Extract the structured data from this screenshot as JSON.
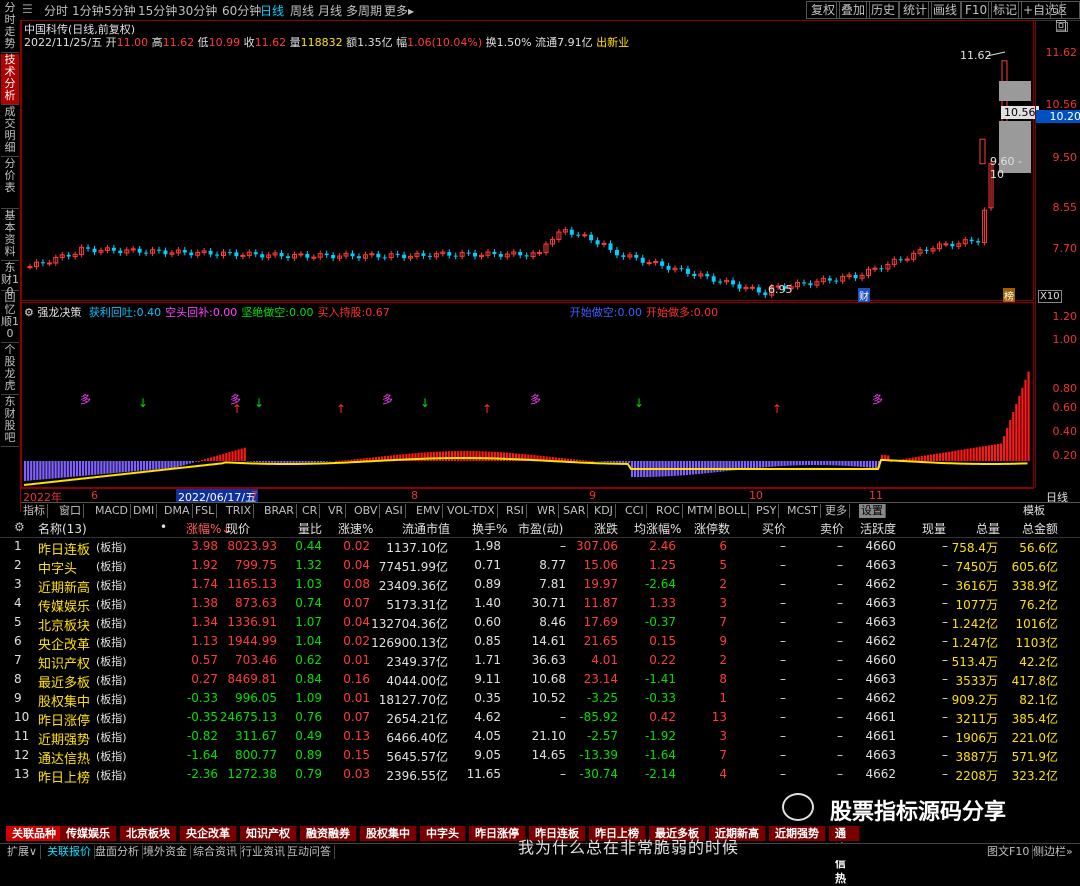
{
  "left_tabs": [
    "分时走势",
    "技术分析",
    "成交明细",
    "分价表",
    "基本资料",
    "东财10",
    "回忆顺10",
    "个股龙虎",
    "东财股吧"
  ],
  "left_active": 1,
  "periods": [
    "分时",
    "1分钟",
    "5分钟",
    "15分钟",
    "30分钟",
    "60分钟",
    "日线",
    "周线",
    "月线",
    "多周期",
    "更多▸"
  ],
  "period_active": 6,
  "right_tools": [
    "复权",
    "叠加",
    "历史",
    "统计",
    "画线",
    "F10",
    "标记",
    "+自选",
    "返回"
  ],
  "stock_title": "中国科传(日线,前复权)",
  "info": {
    "date": "2022/11/25/五",
    "open_l": "开",
    "open": "11.00",
    "high_l": "高",
    "high": "11.62",
    "low_l": "低",
    "low": "10.99",
    "close_l": "收",
    "close": "11.62",
    "vol_l": "量",
    "vol": "118832",
    "amt": "额1.35亿",
    "amp_l": "幅",
    "amp": "1.06(10.04%)",
    "turn": "换1.50%",
    "float": "流通7.91亿",
    "flag": "出新业"
  },
  "price_labels": {
    "high": "11.62",
    "cur": "10.56",
    "cur2": "10.20",
    "range": "9.60 - 10",
    "low": "6.95",
    "cai": "财",
    "bang": "榜",
    "x10": "X10"
  },
  "y_axis_k": [
    "11.62",
    "10.56",
    "9.50",
    "8.55",
    "7.70"
  ],
  "y_axis_ind": [
    "1.20",
    "1.00",
    "0.80",
    "0.60",
    "0.40",
    "0.20"
  ],
  "indicator": {
    "name": "强龙决策",
    "items": [
      {
        "l": "获利回吐:",
        "v": "0.40",
        "c": "#00c0ff"
      },
      {
        "l": "空头回补:",
        "v": "0.00",
        "c": "#ff40ff"
      },
      {
        "l": "坚绝做空:",
        "v": "0.00",
        "c": "#00e000"
      },
      {
        "l": "买入持股:",
        "v": "0.67",
        "c": "#ff3030"
      },
      {
        "l": "开始做空:",
        "v": "0.00",
        "c": "#4060ff"
      },
      {
        "l": "开始做多:",
        "v": "0.00",
        "c": "#ff3030"
      }
    ]
  },
  "duo": "多",
  "x_axis": [
    {
      "t": "2022年",
      "p": 2
    },
    {
      "t": "6",
      "p": 70
    },
    {
      "t": "2022/06/17/五",
      "p": 155,
      "h": true
    },
    {
      "t": "7",
      "p": 230
    },
    {
      "t": "8",
      "p": 390
    },
    {
      "t": "9",
      "p": 568
    },
    {
      "t": "10",
      "p": 728
    },
    {
      "t": "11",
      "p": 848
    }
  ],
  "x_axis_right": "日线",
  "ind_tabs": [
    "指标",
    "窗口",
    "MACD",
    "DMI",
    "DMA",
    "FSL",
    "TRIX",
    "BRAR",
    "CR",
    "VR",
    "OBV",
    "ASI",
    "EMV",
    "VOL-TDX",
    "RSI",
    "WR",
    "SAR",
    "KDJ",
    "CCI",
    "ROC",
    "MTM",
    "BOLL",
    "PSY",
    "MCST",
    "更多",
    "设置"
  ],
  "ind_tab_active": 25,
  "ind_tabs_right": "模板",
  "table_header": [
    "名称(13)",
    "•",
    "涨幅%↓",
    "现价",
    "量比",
    "涨速%",
    "流通市值",
    "换手%",
    "市盈(动)",
    "涨跌",
    "均涨幅%",
    "涨停数",
    "买价",
    "卖价",
    "活跃度",
    "现量",
    "总量",
    "总金额"
  ],
  "rows": [
    [
      "1",
      "昨日连板",
      "(板指)",
      "3.98",
      "8023.93",
      "0.44",
      "0.02",
      "1137.10亿",
      "1.98",
      "–",
      "307.06",
      "2.46",
      "6",
      "–",
      "–",
      "4660",
      "–",
      "758.4万",
      "56.6亿"
    ],
    [
      "2",
      "中字头",
      "(板指)",
      "1.92",
      "799.75",
      "1.32",
      "0.04",
      "77451.99亿",
      "0.71",
      "8.77",
      "15.06",
      "1.25",
      "5",
      "–",
      "–",
      "4663",
      "–",
      "7450万",
      "605.6亿"
    ],
    [
      "3",
      "近期新高",
      "(板指)",
      "1.74",
      "1165.13",
      "1.03",
      "0.08",
      "23409.36亿",
      "0.89",
      "7.81",
      "19.97",
      "-2.64",
      "2",
      "–",
      "–",
      "4662",
      "–",
      "3616万",
      "338.9亿"
    ],
    [
      "4",
      "传媒娱乐",
      "(板指)",
      "1.38",
      "873.63",
      "0.74",
      "0.07",
      "5173.31亿",
      "1.40",
      "30.71",
      "11.87",
      "1.33",
      "3",
      "–",
      "–",
      "4663",
      "–",
      "1077万",
      "76.2亿"
    ],
    [
      "5",
      "北京板块",
      "(板指)",
      "1.34",
      "1336.91",
      "1.07",
      "0.04",
      "132704.36亿",
      "0.60",
      "8.46",
      "17.69",
      "-0.37",
      "7",
      "–",
      "–",
      "4663",
      "–",
      "1.242亿",
      "1016亿"
    ],
    [
      "6",
      "央企改革",
      "(板指)",
      "1.13",
      "1944.99",
      "1.04",
      "0.02",
      "126900.13亿",
      "0.85",
      "14.61",
      "21.65",
      "0.15",
      "9",
      "–",
      "–",
      "4662",
      "–",
      "1.247亿",
      "1103亿"
    ],
    [
      "7",
      "知识产权",
      "(板指)",
      "0.57",
      "703.46",
      "0.62",
      "0.01",
      "2349.37亿",
      "1.71",
      "36.63",
      "4.01",
      "0.22",
      "2",
      "–",
      "–",
      "4660",
      "–",
      "513.4万",
      "42.2亿"
    ],
    [
      "8",
      "最近多板",
      "(板指)",
      "0.27",
      "8469.81",
      "0.84",
      "0.16",
      "4044.00亿",
      "9.11",
      "10.68",
      "23.14",
      "-1.41",
      "8",
      "–",
      "–",
      "4663",
      "–",
      "3533万",
      "417.8亿"
    ],
    [
      "9",
      "股权集中",
      "(板指)",
      "-0.33",
      "996.05",
      "1.09",
      "0.01",
      "18127.70亿",
      "0.35",
      "10.52",
      "-3.25",
      "-0.33",
      "1",
      "–",
      "–",
      "4662",
      "–",
      "909.2万",
      "82.1亿"
    ],
    [
      "10",
      "昨日涨停",
      "(板指)",
      "-0.35",
      "24675.13",
      "0.76",
      "0.07",
      "2654.21亿",
      "4.62",
      "–",
      "-85.92",
      "0.42",
      "13",
      "–",
      "–",
      "4661",
      "–",
      "3211万",
      "385.4亿"
    ],
    [
      "11",
      "近期强势",
      "(板指)",
      "-0.82",
      "311.67",
      "0.49",
      "0.13",
      "6466.40亿",
      "4.05",
      "21.10",
      "-2.57",
      "-1.92",
      "3",
      "–",
      "–",
      "4661",
      "–",
      "1906万",
      "221.0亿"
    ],
    [
      "12",
      "通达信热",
      "(板指)",
      "-1.64",
      "800.77",
      "0.89",
      "0.15",
      "5645.57亿",
      "9.05",
      "14.65",
      "-13.39",
      "-1.64",
      "7",
      "–",
      "–",
      "4663",
      "–",
      "3887万",
      "571.9亿"
    ],
    [
      "13",
      "昨日上榜",
      "(板指)",
      "-2.36",
      "1272.38",
      "0.79",
      "0.03",
      "2396.55亿",
      "11.65",
      "–",
      "-30.74",
      "-2.14",
      "4",
      "–",
      "–",
      "4662",
      "–",
      "2208万",
      "323.2亿"
    ]
  ],
  "watermark": "股票指标源码分享",
  "subtitle": "我为什么总在非常脆弱的时候",
  "sectors": [
    "关联品种",
    "传媒娱乐",
    "北京板块",
    "央企改革",
    "知识产权",
    "融资融券",
    "股权集中",
    "中字头",
    "昨日涨停",
    "昨日连板",
    "昨日上榜",
    "最近多板",
    "近期新高",
    "近期强势",
    "通达信热"
  ],
  "bottom": [
    "扩展∨",
    "关联报价",
    "盘面分析",
    "境外资金",
    "综合资讯",
    "行业资讯",
    "互动问答"
  ],
  "bottom_right": [
    "图文F10",
    "侧边栏»"
  ],
  "colors": {
    "up": "#ff3b3b",
    "down": "#00d0ff",
    "border": "#8b0000"
  }
}
